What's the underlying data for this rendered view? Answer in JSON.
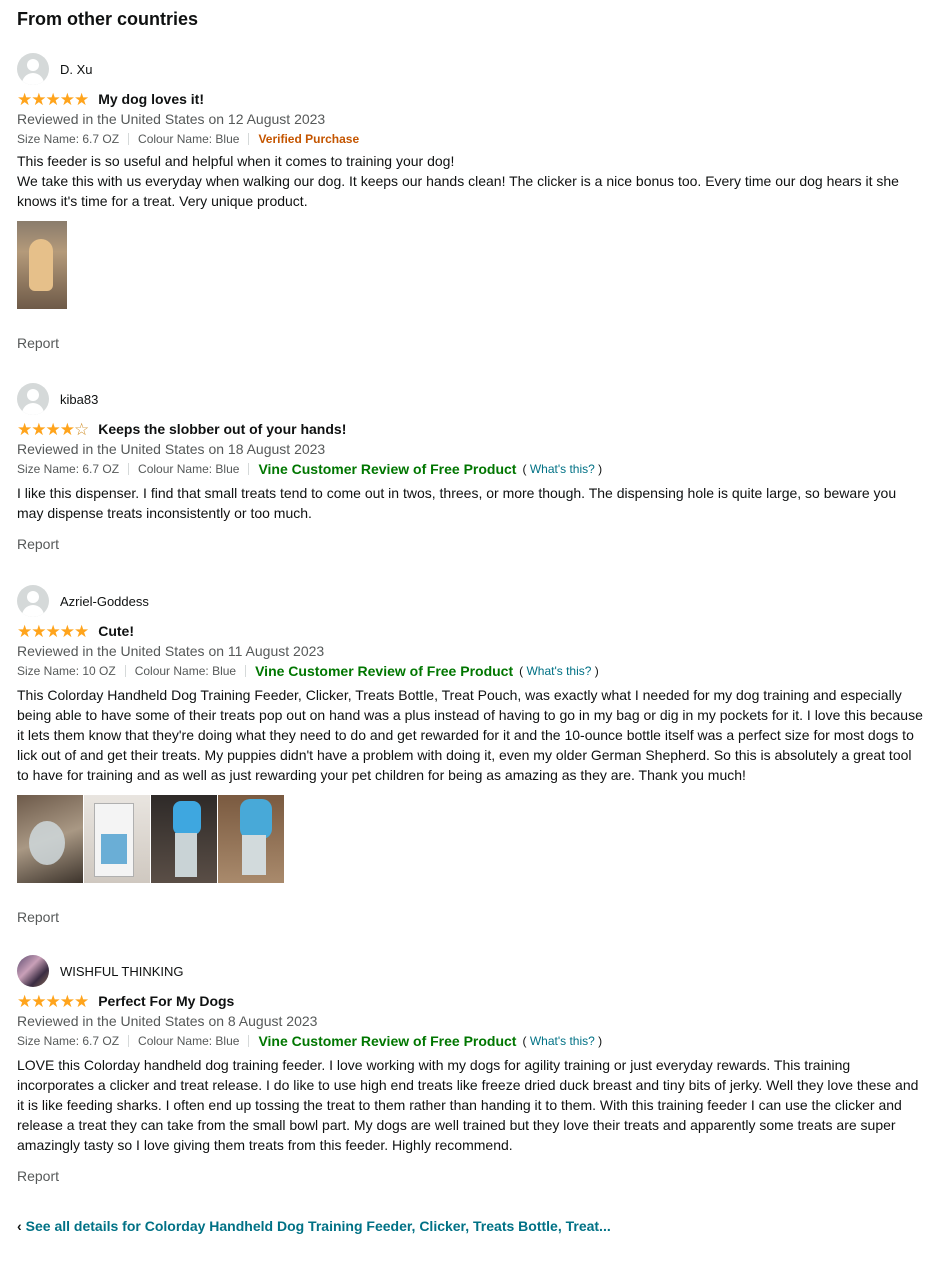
{
  "section_title": "From other countries",
  "reviews": [
    {
      "profile_name": "D. Xu",
      "rating": 5,
      "title": "My dog loves it!",
      "date": "Reviewed in the United States on 12 August 2023",
      "size": "Size Name: 6.7 OZ",
      "colour": "Colour Name: Blue",
      "badge": "Verified Purchase",
      "body": [
        "This feeder is so useful and helpful when it comes to training your dog!",
        "We take this with us everyday when walking our dog. It keeps our hands clean! The clicker is a nice bonus too. Every time our dog hears it she knows it's time for a treat. Very unique product."
      ],
      "report": "Report"
    },
    {
      "profile_name": "kiba83",
      "rating": 4,
      "title": "Keeps the slobber out of your hands!",
      "date": "Reviewed in the United States on 18 August 2023",
      "size": "Size Name: 6.7 OZ",
      "colour": "Colour Name: Blue",
      "badge": "Vine Customer Review of Free Product",
      "whats_this": "What's this?",
      "body": [
        "I like this dispenser. I find that small treats tend to come out in twos, threes, or more though. The dispensing hole is quite large, so beware you may dispense treats inconsistently or too much."
      ],
      "report": "Report"
    },
    {
      "profile_name": "Azriel-Goddess",
      "rating": 5,
      "title": "Cute!",
      "date": "Reviewed in the United States on 11 August 2023",
      "size": "Size Name: 10 OZ",
      "colour": "Colour Name: Blue",
      "badge": "Vine Customer Review of Free Product",
      "whats_this": "What's this?",
      "body": [
        "This Colorday Handheld Dog Training Feeder, Clicker, Treats Bottle, Treat Pouch, was exactly what I needed for my dog training and especially being able to have some of their treats pop out on hand was a plus instead of having to go in my bag or dig in my pockets for it. I love this because it lets them know that they're doing what they need to do and get rewarded for it and the 10-ounce bottle itself was a perfect size for most dogs to lick out of and get their treats. My puppies didn't have a problem with doing it, even my older German Shepherd. So this is absolutely a great tool to have for training and as well as just rewarding your pet children for being as amazing as they are. Thank you much!"
      ],
      "report": "Report"
    },
    {
      "profile_name": "WISHFUL THINKING",
      "rating": 5,
      "title": "Perfect For My Dogs",
      "date": "Reviewed in the United States on 8 August 2023",
      "size": "Size Name: 6.7 OZ",
      "colour": "Colour Name: Blue",
      "badge": "Vine Customer Review of Free Product",
      "whats_this": "What's this?",
      "body": [
        "LOVE this Colorday handheld dog training feeder. I love working with my dogs for agility training or just everyday rewards. This training incorporates a clicker and treat release. I do like to use high end treats like freeze dried duck breast and tiny bits of jerky. Well they love these and it is like feeding sharks. I often end up tossing the treat to them rather than handing it to them. With this training feeder I can use the clicker and release a treat they can take from the small bowl part. My dogs are well trained but they love their treats and apparently some treats are super amazingly tasty so I love giving them treats from this feeder. Highly recommend."
      ],
      "report": "Report"
    }
  ],
  "see_all": {
    "chevron": "‹",
    "label": "See all details for Colorday Handheld Dog Training Feeder, Clicker, Treats Bottle, Treat..."
  },
  "colors": {
    "star": "#FFA41C",
    "link": "#007185",
    "verified": "#C45500",
    "vine": "#007600",
    "secondary_text": "#565959"
  }
}
